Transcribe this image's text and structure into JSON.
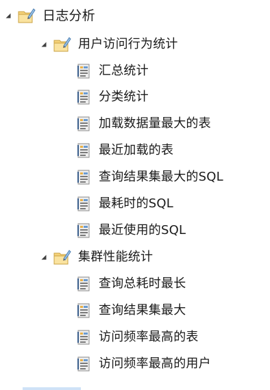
{
  "tree": {
    "root": {
      "label": "日志分析",
      "icon": "folder-edit-icon",
      "expanded": true,
      "children": [
        {
          "label": "用户访问行为统计",
          "icon": "folder-edit-icon",
          "expanded": true,
          "children": [
            {
              "label": "汇总统计",
              "icon": "report-icon"
            },
            {
              "label": "分类统计",
              "icon": "report-icon"
            },
            {
              "label": "加载数据量最大的表",
              "icon": "report-icon"
            },
            {
              "label": "最近加载的表",
              "icon": "report-icon"
            },
            {
              "label": "查询结果集最大的SQL",
              "icon": "report-icon"
            },
            {
              "label": "最耗时的SQL",
              "icon": "report-icon"
            },
            {
              "label": "最近使用的SQL",
              "icon": "report-icon"
            }
          ]
        },
        {
          "label": "集群性能统计",
          "icon": "folder-edit-icon",
          "expanded": true,
          "children": [
            {
              "label": "查询总耗时最长",
              "icon": "report-icon"
            },
            {
              "label": "查询结果集最大",
              "icon": "report-icon"
            },
            {
              "label": "访问频率最高的表",
              "icon": "report-icon"
            },
            {
              "label": "访问频率最高的用户",
              "icon": "report-icon"
            }
          ]
        }
      ]
    }
  }
}
